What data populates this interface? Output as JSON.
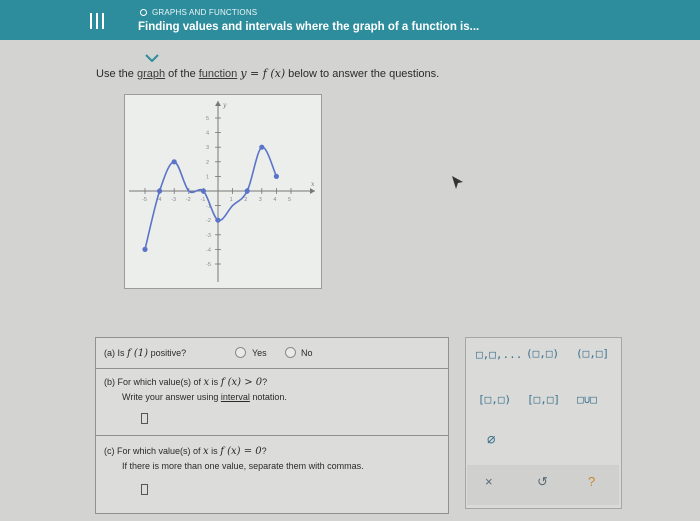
{
  "header": {
    "topic": "GRAPHS AND FUNCTIONS",
    "title": "Finding values and intervals where the graph of a function is..."
  },
  "instructions": {
    "prefix": "Use the ",
    "link1": "graph",
    "mid": " of the ",
    "link2": "function",
    "math": "y = f (x)",
    "suffix": " below to answer the questions."
  },
  "graph": {
    "x_axis_label": "x",
    "y_axis_label": "y",
    "x_tick_labels": [
      "-5",
      "-4",
      "-3",
      "-2",
      "-1",
      "1",
      "2",
      "3",
      "4",
      "5"
    ],
    "y_tick_labels": [
      "5",
      "4",
      "3",
      "2",
      "1",
      "-1",
      "-2",
      "-3",
      "-4",
      "-5"
    ],
    "curve_points": [
      [
        -5,
        -4
      ],
      [
        -4,
        0
      ],
      [
        -3,
        2
      ],
      [
        -2,
        0
      ],
      [
        -1,
        0
      ],
      [
        0,
        -2
      ],
      [
        1,
        -1
      ],
      [
        2,
        0
      ],
      [
        3,
        3
      ],
      [
        4,
        1
      ]
    ],
    "marked_points": [
      [
        -5,
        -4
      ],
      [
        -4,
        0
      ],
      [
        -3,
        2
      ],
      [
        -1,
        0
      ],
      [
        0,
        -2
      ],
      [
        2,
        0
      ],
      [
        3,
        3
      ],
      [
        4,
        1
      ]
    ],
    "curve_color": "#5b74c9",
    "xlim": [
      -6,
      6
    ],
    "ylim": [
      -6,
      6
    ]
  },
  "questions": {
    "a": {
      "prefix": "(a)  Is ",
      "math": "f (1)",
      "suffix": " positive?",
      "option_yes": "Yes",
      "option_no": "No"
    },
    "b": {
      "prefix": "(b)  For which value(s) of ",
      "var": "x",
      "is_text": " is ",
      "math": "f (x) > 0",
      "qmark": "?",
      "line2_prefix": "Write your answer using ",
      "line2_link": "interval",
      "line2_suffix": " notation."
    },
    "c": {
      "prefix": "(c)  For which value(s) of ",
      "var": "x",
      "is_text": " is ",
      "math": "f (x) = 0",
      "qmark": "?",
      "line2": "If there is more than one value, separate them with commas."
    }
  },
  "keypad": {
    "keys": [
      "□,□,...",
      "(□,□)",
      "(□,□]",
      "[□,□)",
      "[□,□]",
      "□∪□",
      "∅"
    ],
    "clear": "×",
    "undo": "↺",
    "help": "?"
  }
}
